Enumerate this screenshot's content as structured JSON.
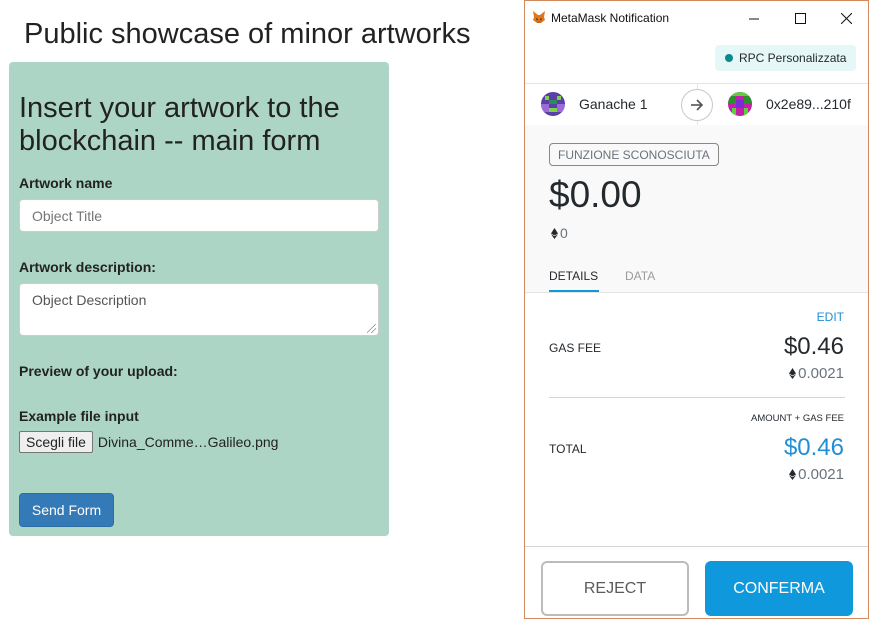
{
  "page": {
    "title": "Public showcase of minor artworks"
  },
  "form": {
    "heading": "Insert your artwork to the blockchain -- main form",
    "name_label": "Artwork name",
    "name_placeholder": "Object Title",
    "description_label": "Artwork description:",
    "description_placeholder": "Object Description",
    "preview_label": "Preview of your upload:",
    "file_label": "Example file input",
    "file_button": "Scegli file",
    "file_name": "Divina_Comme…Galileo.png",
    "send_button": "Send Form",
    "panel_color": "#acd5c6",
    "send_color": "#337ab7"
  },
  "metamask": {
    "window_title": "MetaMask Notification",
    "network": "RPC Personalizzata",
    "from_account": "Ganache 1",
    "to_address": "0x2e89...210f",
    "method_badge": "FUNZIONE SCONOSCIUTA",
    "amount_fiat": "$0.00",
    "amount_eth": "0",
    "tabs": [
      "DETAILS",
      "DATA"
    ],
    "edit_label": "EDIT",
    "gas_fee_label": "GAS FEE",
    "gas_fee_fiat": "$0.46",
    "gas_fee_eth": "0.0021",
    "amount_gas_label": "AMOUNT + GAS FEE",
    "total_label": "TOTAL",
    "total_fiat": "$0.46",
    "total_eth": "0.0021",
    "reject_button": "REJECT",
    "confirm_button": "CONFERMA",
    "accent_color": "#1098dc"
  }
}
